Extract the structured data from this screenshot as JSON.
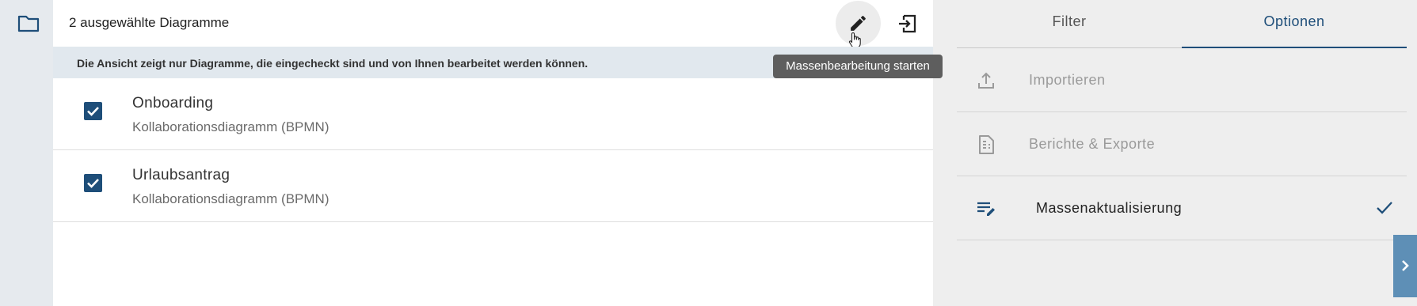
{
  "main": {
    "title": "2 ausgewählte Diagramme",
    "info": "Die Ansicht zeigt nur Diagramme, die eingecheckt sind und von Ihnen bearbeitet werden können.",
    "tooltip": "Massenbearbeitung starten",
    "items": [
      {
        "title": "Onboarding",
        "subtitle": "Kollaborationsdiagramm (BPMN)",
        "checked": true
      },
      {
        "title": "Urlaubsantrag",
        "subtitle": "Kollaborationsdiagramm (BPMN)",
        "checked": true
      }
    ]
  },
  "right": {
    "tabs": [
      {
        "label": "Filter",
        "active": false
      },
      {
        "label": "Optionen",
        "active": true
      }
    ],
    "options": [
      {
        "label": "Importieren",
        "icon": "upload-icon",
        "active": false
      },
      {
        "label": "Berichte & Exporte",
        "icon": "report-icon",
        "active": false
      },
      {
        "label": "Massenaktualisierung",
        "icon": "edit-list-icon",
        "active": true
      }
    ]
  },
  "colors": {
    "accent": "#1e4e79",
    "info_bar": "#e1e8ee",
    "tooltip_bg": "#5e5e5e",
    "expand_tab": "#5e8fb6"
  }
}
